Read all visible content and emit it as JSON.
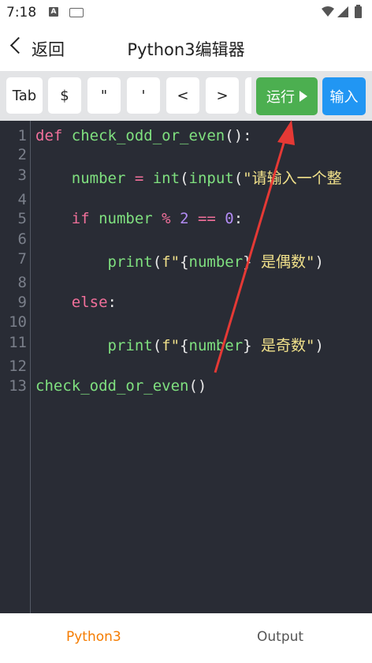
{
  "status": {
    "time": "7:18",
    "a_icon_label": "A"
  },
  "header": {
    "back_label": "返回",
    "title": "Python3编辑器"
  },
  "toolbar": {
    "keys": [
      "Tab",
      "$",
      "\"",
      "'",
      "<",
      ">"
    ],
    "run_label": "运行",
    "input_label": "输入"
  },
  "editor": {
    "line_numbers": [
      "1",
      "2",
      "3",
      "4",
      "5",
      "6",
      "7",
      "8",
      "9",
      "10",
      "11",
      "12",
      "13"
    ],
    "line1": {
      "kw": "def",
      "fn": "check_odd_or_even",
      "rest": "():"
    },
    "line3": {
      "indent": "    ",
      "var": "number",
      "op": " = ",
      "fn1": "int",
      "p1": "(",
      "fn2": "input",
      "p2": "(",
      "str": "\"请输入一个整"
    },
    "line5": {
      "indent": "    ",
      "kw": "if",
      "var": " number ",
      "op": "%",
      "num1": " 2 ",
      "op2": "==",
      "num2": " 0",
      "rest": ":"
    },
    "line7": {
      "indent": "        ",
      "fn": "print",
      "p": "(",
      "str1": "f\"",
      "brace1": "{",
      "var": "number",
      "brace2": "}",
      "str2": " 是偶数\"",
      "close": ")"
    },
    "line9": {
      "indent": "    ",
      "kw": "else",
      "rest": ":"
    },
    "line11": {
      "indent": "        ",
      "fn": "print",
      "p": "(",
      "str1": "f\"",
      "brace1": "{",
      "var": "number",
      "brace2": "}",
      "str2": " 是奇数\"",
      "close": ")"
    },
    "line13": {
      "fn": "check_odd_or_even",
      "rest": "()"
    }
  },
  "bottom_nav": {
    "tab_python": "Python3",
    "tab_output": "Output"
  },
  "colors": {
    "accent": "#f57c00",
    "run": "#4caf50",
    "input": "#2196f3",
    "editor_bg": "#292c35",
    "arrow": "#e53935"
  }
}
